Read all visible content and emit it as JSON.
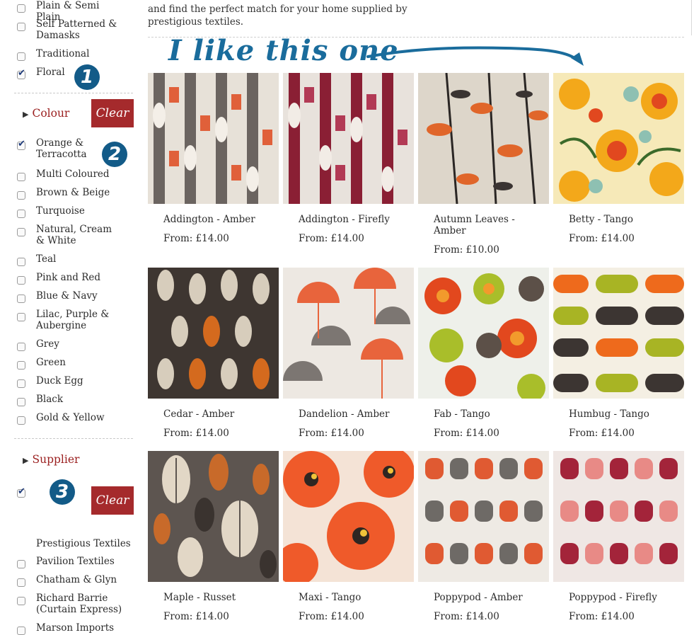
{
  "intro_text": "and find the perfect match for your home supplied by prestigious textiles.",
  "annotation": "I like this one",
  "filters_top": [
    {
      "label": "Plain & Semi Plain",
      "checked": false
    },
    {
      "label": "Self Patterned & Damasks",
      "checked": false
    },
    {
      "label": "Traditional",
      "checked": false
    },
    {
      "label": "Floral",
      "checked": true
    }
  ],
  "colour": {
    "title": "Colour",
    "clear_label": "Clear",
    "items": [
      {
        "label": "Orange & Terracotta",
        "checked": true
      },
      {
        "label": "Multi Coloured",
        "checked": false
      },
      {
        "label": "Brown & Beige",
        "checked": false
      },
      {
        "label": "Turquoise",
        "checked": false
      },
      {
        "label": "Natural, Cream & White",
        "checked": false
      },
      {
        "label": "Teal",
        "checked": false
      },
      {
        "label": "Pink and Red",
        "checked": false
      },
      {
        "label": "Blue & Navy",
        "checked": false
      },
      {
        "label": "Lilac, Purple & Aubergine",
        "checked": false
      },
      {
        "label": "Grey",
        "checked": false
      },
      {
        "label": "Green",
        "checked": false
      },
      {
        "label": "Duck Egg",
        "checked": false
      },
      {
        "label": "Black",
        "checked": false
      },
      {
        "label": "Gold & Yellow",
        "checked": false
      }
    ]
  },
  "supplier": {
    "title": "Supplier",
    "clear_label": "Clear",
    "checked_item": {
      "label": "",
      "checked": true
    },
    "items": [
      {
        "label": "Prestigious Textiles",
        "checked": null
      },
      {
        "label": "Pavilion Textiles",
        "checked": false
      },
      {
        "label": "Chatham & Glyn",
        "checked": false
      },
      {
        "label": "Richard Barrie (Curtain Express)",
        "checked": false
      },
      {
        "label": "Marson Imports",
        "checked": false
      }
    ]
  },
  "badges": [
    "1",
    "2",
    "3"
  ],
  "products": [
    {
      "name": "Addington - Amber",
      "price": "From: £14.00"
    },
    {
      "name": "Addington - Firefly",
      "price": "From: £14.00"
    },
    {
      "name": "Autumn Leaves - Amber",
      "price": "From: £10.00"
    },
    {
      "name": "Betty - Tango",
      "price": "From: £14.00"
    },
    {
      "name": "Cedar - Amber",
      "price": "From: £14.00"
    },
    {
      "name": "Dandelion - Amber",
      "price": "From: £14.00"
    },
    {
      "name": "Fab - Tango",
      "price": "From: £14.00"
    },
    {
      "name": "Humbug - Tango",
      "price": "From: £14.00"
    },
    {
      "name": "Maple - Russet",
      "price": "From: £14.00"
    },
    {
      "name": "Maxi - Tango",
      "price": "From: £14.00"
    },
    {
      "name": "Poppypod - Amber",
      "price": "From: £14.00"
    },
    {
      "name": "Poppypod - Firefly",
      "price": "From: £14.00"
    }
  ],
  "colors": {
    "accent": "#a52a2c",
    "badge": "#135b88",
    "annotation": "#1a6c9c"
  }
}
